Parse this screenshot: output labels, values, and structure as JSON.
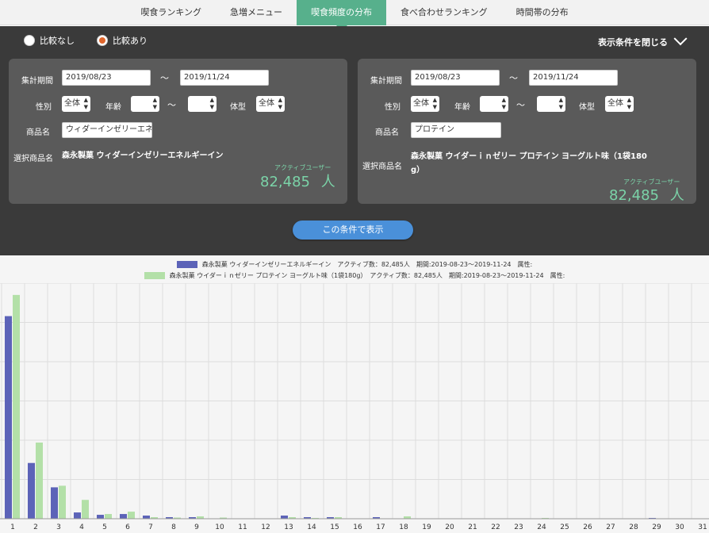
{
  "tabs": [
    {
      "label": "喫食ランキング",
      "active": false
    },
    {
      "label": "急増メニュー",
      "active": false
    },
    {
      "label": "喫食頻度の分布",
      "active": true
    },
    {
      "label": "食べ合わせランキング",
      "active": false
    },
    {
      "label": "時間帯の分布",
      "active": false
    }
  ],
  "compare": {
    "no_compare": "比較なし",
    "with_compare": "比較あり",
    "selected": "with_compare"
  },
  "close_conditions": "表示条件を閉じる",
  "labels": {
    "period": "集計期間",
    "tilde": "〜",
    "gender": "性別",
    "age": "年齢",
    "body": "体型",
    "product": "商品名",
    "selected_product": "選択商品名",
    "active_users": "アクティブユーザー",
    "unit": "人"
  },
  "left": {
    "date_from": "2019/08/23",
    "date_to": "2019/11/24",
    "gender": "全体",
    "age_from": "",
    "age_to": "",
    "body": "全体",
    "product_input": "ウィダーインゼリーエネル",
    "selected_product": "森永製菓 ウィダーインゼリーエネルギーイン",
    "active_count": "82,485"
  },
  "right": {
    "date_from": "2019/08/23",
    "date_to": "2019/11/24",
    "gender": "全体",
    "age_from": "",
    "age_to": "",
    "body": "全体",
    "product_input": "プロテイン",
    "selected_product_line1": "森永製菓 ウイダーｉｎゼリー プロテイン ヨーグルト味（1袋180",
    "selected_product_line2": "g）",
    "active_count": "82,485"
  },
  "show_button": "この条件で表示",
  "legend": [
    {
      "text": "森永製菓 ウィダーインゼリーエネルギーイン　アクティブ数：82,485人　期間:2019-08-23〜2019-11-24　属性:",
      "color": "#5c63b8"
    },
    {
      "text": "森永製菓 ウイダーｉｎゼリー プロテイン ヨーグルト味（1袋180g）　アクティブ数：82,485人　期間:2019-08-23〜2019-11-24　属性:",
      "color": "#b3e0a8"
    }
  ],
  "chart_data": {
    "type": "bar",
    "categories": [
      "1",
      "2",
      "3",
      "4",
      "5",
      "6",
      "7",
      "8",
      "9",
      "10",
      "11",
      "12",
      "13",
      "14",
      "15",
      "16",
      "17",
      "18",
      "19",
      "20",
      "21",
      "22",
      "23",
      "24",
      "25",
      "26",
      "27",
      "28",
      "29",
      "30",
      "31"
    ],
    "series": [
      {
        "values": [
          258,
          71,
          40,
          8,
          5,
          6,
          4,
          2,
          2,
          0.5,
          0,
          0,
          4,
          2,
          2,
          0.5,
          2,
          0.5,
          0.5,
          0,
          0,
          0,
          0,
          0.5,
          0,
          0,
          0,
          0,
          1,
          0,
          0
        ],
        "color": "#5c63b8"
      },
      {
        "values": [
          285,
          97,
          42,
          24,
          6,
          9,
          2,
          1.5,
          3,
          1.5,
          0,
          0,
          2,
          1,
          2,
          0.5,
          0.5,
          3,
          0.5,
          0,
          0,
          0,
          0,
          1,
          0,
          0,
          0,
          0,
          0.5,
          0,
          0
        ],
        "color": "#b3e0a8"
      }
    ],
    "ylim": [
      0,
      300
    ],
    "grid": true,
    "legend_position": "top-center"
  }
}
